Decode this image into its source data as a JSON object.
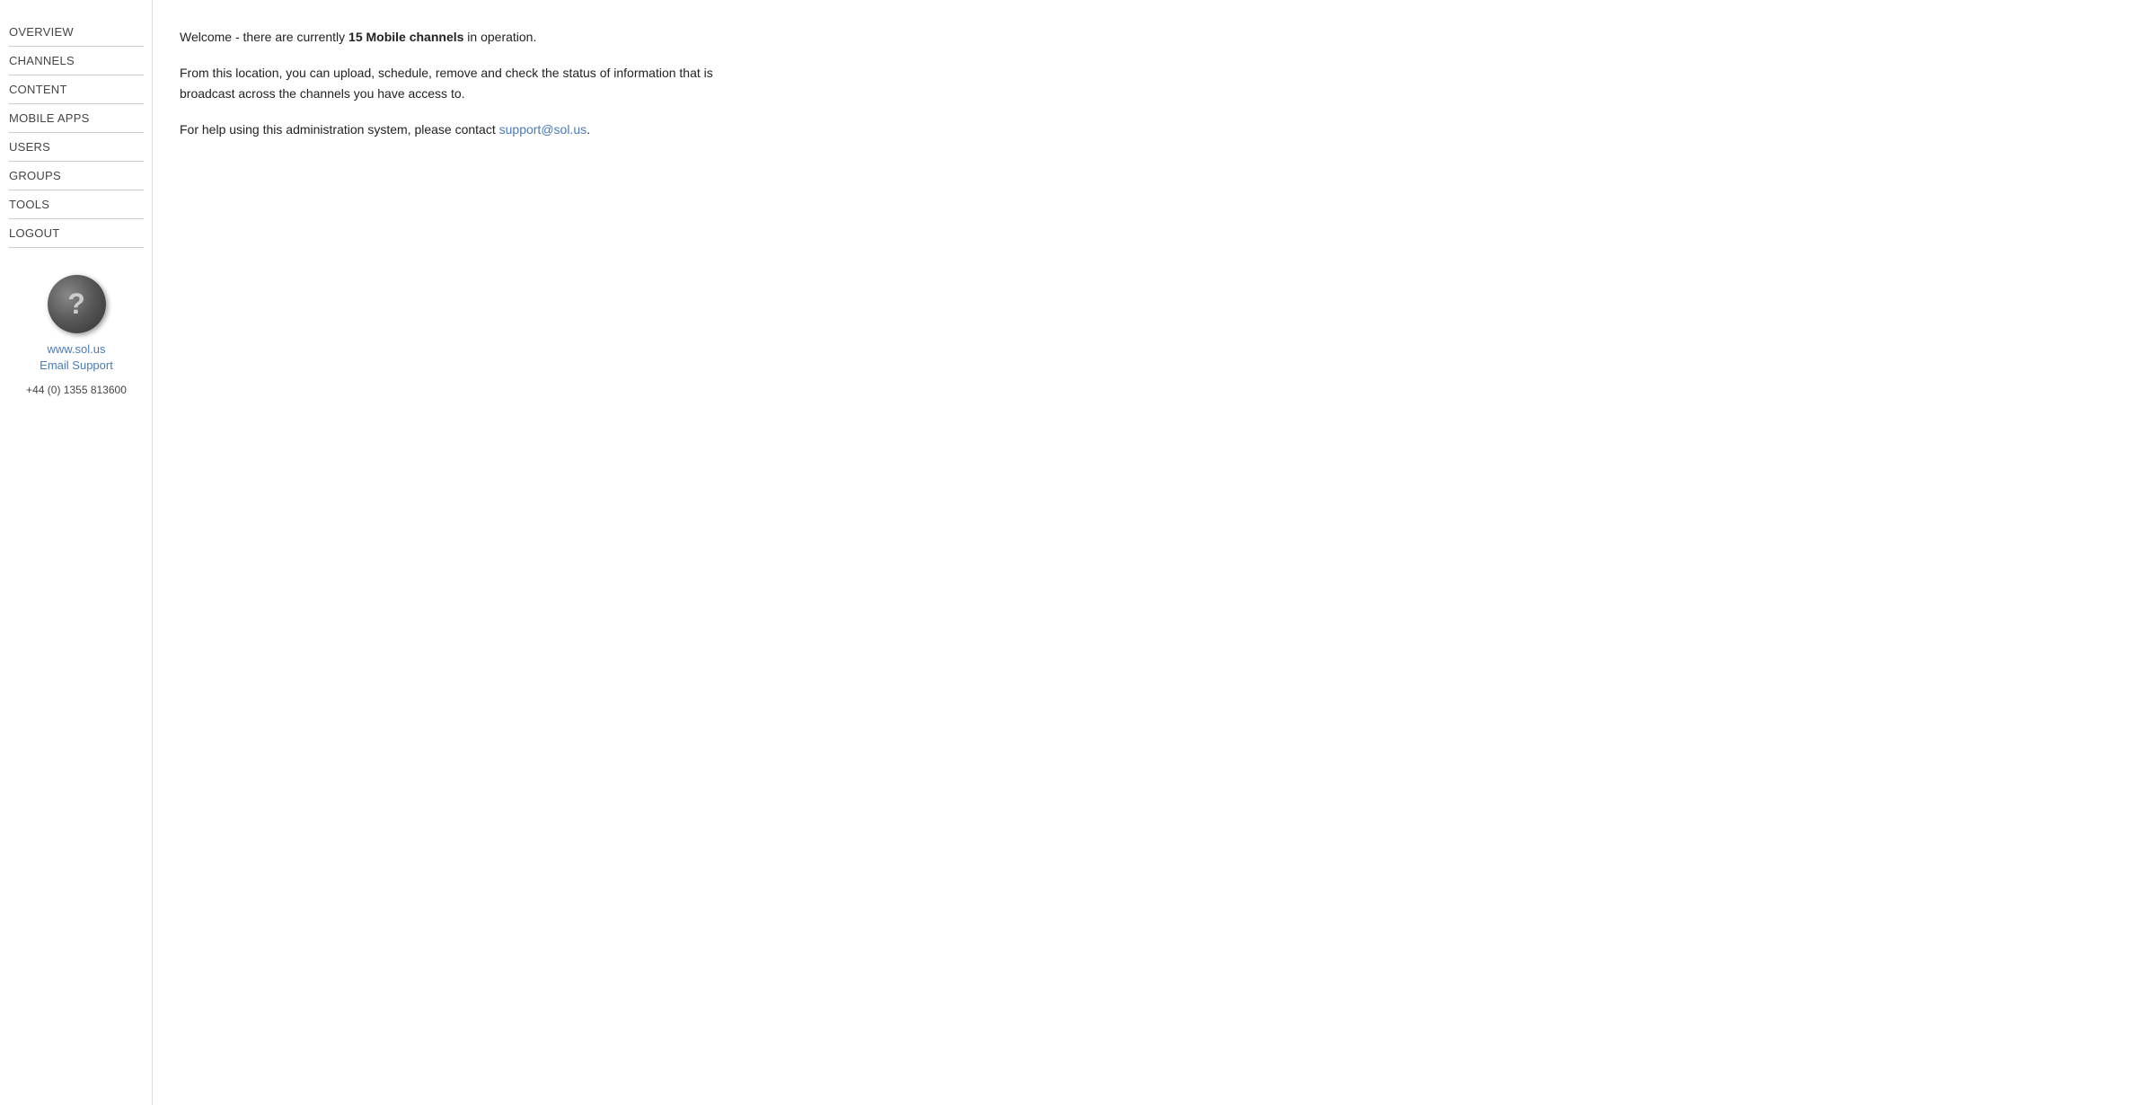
{
  "sidebar": {
    "nav_items": [
      {
        "label": "OVERVIEW",
        "id": "overview"
      },
      {
        "label": "CHANNELS",
        "id": "channels"
      },
      {
        "label": "CONTENT",
        "id": "content"
      },
      {
        "label": "MOBILE APPS",
        "id": "mobile-apps"
      },
      {
        "label": "USERS",
        "id": "users"
      },
      {
        "label": "GROUPS",
        "id": "groups"
      },
      {
        "label": "TOOLS",
        "id": "tools"
      },
      {
        "label": "LOGOUT",
        "id": "logout"
      }
    ],
    "support": {
      "website_label": "www.sol.us",
      "website_url": "http://www.sol.us",
      "email_label": "Email Support",
      "email_url": "mailto:support@sol.us",
      "phone": "+44 (0) 1355 813600",
      "help_icon": "?"
    }
  },
  "main": {
    "welcome_prefix": "Welcome - there are currently ",
    "channel_count": "15",
    "channel_label": "Mobile channels",
    "welcome_suffix": " in operation.",
    "info_text": "From this location, you can upload, schedule, remove and check the status of information that is broadcast across the channels you have access to.",
    "help_prefix": "For help using this administration system, please contact ",
    "support_email": "support@sol.us",
    "help_suffix": "."
  }
}
